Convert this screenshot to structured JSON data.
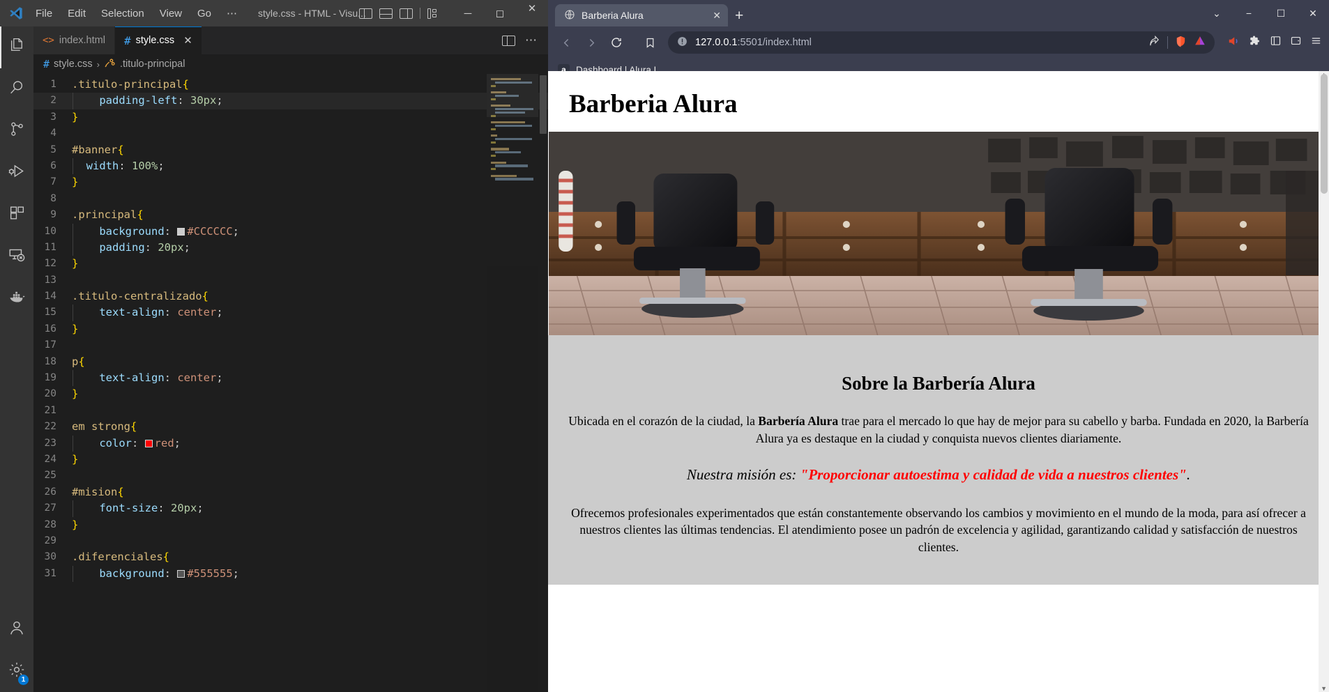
{
  "vscode": {
    "window_title": "style.css - HTML - Visu...",
    "menu": [
      "File",
      "Edit",
      "Selection",
      "View",
      "Go",
      "⋯"
    ],
    "layout_icons": [
      "panel-left-icon",
      "panel-bottom-icon",
      "panel-right-icon",
      "customize-layout-icon"
    ],
    "window_controls": [
      "minimize",
      "maximize",
      "close"
    ],
    "activity_bar": [
      {
        "name": "explorer",
        "icon": "files-icon"
      },
      {
        "name": "search",
        "icon": "search-icon"
      },
      {
        "name": "source-control",
        "icon": "source-control-icon"
      },
      {
        "name": "run-debug",
        "icon": "run-and-debug-icon"
      },
      {
        "name": "extensions",
        "icon": "extensions-icon"
      },
      {
        "name": "remote-explorer",
        "icon": "remote-explorer-icon"
      },
      {
        "name": "docker",
        "icon": "docker-icon"
      }
    ],
    "activity_bar_bottom": [
      {
        "name": "accounts",
        "icon": "account-icon"
      },
      {
        "name": "settings",
        "icon": "gear-icon",
        "badge": "1"
      }
    ],
    "tabs": [
      {
        "label": "index.html",
        "icon": "html-file-icon",
        "active": false
      },
      {
        "label": "style.css",
        "icon": "css-file-icon",
        "active": true
      }
    ],
    "tab_close_label": "✕",
    "tab_actions": [
      "split-editor-icon",
      "more-actions-icon"
    ],
    "breadcrumb": {
      "file_icon": "css-file-icon",
      "file": "style.css",
      "separator": "›",
      "symbol_icon": "css-selector-icon",
      "symbol": ".titulo-principal"
    },
    "code_lines": [
      {
        "n": 1,
        "tokens": [
          {
            "t": ".titulo-principal",
            "c": "k-sel"
          },
          {
            "t": "{",
            "c": "k-brace"
          }
        ]
      },
      {
        "n": 2,
        "hl": true,
        "indent": true,
        "tokens": [
          {
            "t": "    ",
            "c": "k-punc"
          },
          {
            "t": "padding-left",
            "c": "k-prop"
          },
          {
            "t": ": ",
            "c": "k-punc"
          },
          {
            "t": "30px",
            "c": "k-num"
          },
          {
            "t": ";",
            "c": "k-punc"
          }
        ]
      },
      {
        "n": 3,
        "tokens": [
          {
            "t": "}",
            "c": "k-brace"
          }
        ]
      },
      {
        "n": 4,
        "tokens": []
      },
      {
        "n": 5,
        "tokens": [
          {
            "t": "#banner",
            "c": "k-sel"
          },
          {
            "t": "{",
            "c": "k-brace"
          }
        ]
      },
      {
        "n": 6,
        "indent": true,
        "tokens": [
          {
            "t": "  ",
            "c": "k-punc"
          },
          {
            "t": "width",
            "c": "k-prop"
          },
          {
            "t": ": ",
            "c": "k-punc"
          },
          {
            "t": "100%",
            "c": "k-num"
          },
          {
            "t": ";",
            "c": "k-punc"
          }
        ]
      },
      {
        "n": 7,
        "tokens": [
          {
            "t": "}",
            "c": "k-brace"
          }
        ]
      },
      {
        "n": 8,
        "tokens": []
      },
      {
        "n": 9,
        "tokens": [
          {
            "t": ".principal",
            "c": "k-sel"
          },
          {
            "t": "{",
            "c": "k-brace"
          }
        ]
      },
      {
        "n": 10,
        "indent": true,
        "swatch": "#CCCCCC",
        "tokens": [
          {
            "t": "    ",
            "c": "k-punc"
          },
          {
            "t": "background",
            "c": "k-prop"
          },
          {
            "t": ": ",
            "c": "k-punc"
          },
          {
            "t": "#CCCCCC",
            "c": "k-val"
          },
          {
            "t": ";",
            "c": "k-punc"
          }
        ]
      },
      {
        "n": 11,
        "indent": true,
        "tokens": [
          {
            "t": "    ",
            "c": "k-punc"
          },
          {
            "t": "padding",
            "c": "k-prop"
          },
          {
            "t": ": ",
            "c": "k-punc"
          },
          {
            "t": "20px",
            "c": "k-num"
          },
          {
            "t": ";",
            "c": "k-punc"
          }
        ]
      },
      {
        "n": 12,
        "tokens": [
          {
            "t": "}",
            "c": "k-brace"
          }
        ]
      },
      {
        "n": 13,
        "tokens": []
      },
      {
        "n": 14,
        "tokens": [
          {
            "t": ".titulo-centralizado",
            "c": "k-sel"
          },
          {
            "t": "{",
            "c": "k-brace"
          }
        ]
      },
      {
        "n": 15,
        "indent": true,
        "tokens": [
          {
            "t": "    ",
            "c": "k-punc"
          },
          {
            "t": "text-align",
            "c": "k-prop"
          },
          {
            "t": ": ",
            "c": "k-punc"
          },
          {
            "t": "center",
            "c": "k-val"
          },
          {
            "t": ";",
            "c": "k-punc"
          }
        ]
      },
      {
        "n": 16,
        "tokens": [
          {
            "t": "}",
            "c": "k-brace"
          }
        ]
      },
      {
        "n": 17,
        "tokens": []
      },
      {
        "n": 18,
        "tokens": [
          {
            "t": "p",
            "c": "k-tag"
          },
          {
            "t": "{",
            "c": "k-brace"
          }
        ]
      },
      {
        "n": 19,
        "indent": true,
        "tokens": [
          {
            "t": "    ",
            "c": "k-punc"
          },
          {
            "t": "text-align",
            "c": "k-prop"
          },
          {
            "t": ": ",
            "c": "k-punc"
          },
          {
            "t": "center",
            "c": "k-val"
          },
          {
            "t": ";",
            "c": "k-punc"
          }
        ]
      },
      {
        "n": 20,
        "tokens": [
          {
            "t": "}",
            "c": "k-brace"
          }
        ]
      },
      {
        "n": 21,
        "tokens": []
      },
      {
        "n": 22,
        "tokens": [
          {
            "t": "em strong",
            "c": "k-tag"
          },
          {
            "t": "{",
            "c": "k-brace"
          }
        ]
      },
      {
        "n": 23,
        "indent": true,
        "swatch": "#ff0000",
        "tokens": [
          {
            "t": "    ",
            "c": "k-punc"
          },
          {
            "t": "color",
            "c": "k-prop"
          },
          {
            "t": ": ",
            "c": "k-punc"
          },
          {
            "t": "red",
            "c": "k-val"
          },
          {
            "t": ";",
            "c": "k-punc"
          }
        ]
      },
      {
        "n": 24,
        "tokens": [
          {
            "t": "}",
            "c": "k-brace"
          }
        ]
      },
      {
        "n": 25,
        "tokens": []
      },
      {
        "n": 26,
        "tokens": [
          {
            "t": "#mision",
            "c": "k-sel"
          },
          {
            "t": "{",
            "c": "k-brace"
          }
        ]
      },
      {
        "n": 27,
        "indent": true,
        "tokens": [
          {
            "t": "    ",
            "c": "k-punc"
          },
          {
            "t": "font-size",
            "c": "k-prop"
          },
          {
            "t": ": ",
            "c": "k-punc"
          },
          {
            "t": "20px",
            "c": "k-num"
          },
          {
            "t": ";",
            "c": "k-punc"
          }
        ]
      },
      {
        "n": 28,
        "tokens": [
          {
            "t": "}",
            "c": "k-brace"
          }
        ]
      },
      {
        "n": 29,
        "tokens": []
      },
      {
        "n": 30,
        "tokens": [
          {
            "t": ".diferenciales",
            "c": "k-sel"
          },
          {
            "t": "{",
            "c": "k-brace"
          }
        ]
      },
      {
        "n": 31,
        "indent": true,
        "swatch": "#555555",
        "tokens": [
          {
            "t": "    ",
            "c": "k-punc"
          },
          {
            "t": "background",
            "c": "k-prop"
          },
          {
            "t": ": ",
            "c": "k-punc"
          },
          {
            "t": "#555555",
            "c": "k-val"
          },
          {
            "t": ";",
            "c": "k-punc"
          }
        ]
      }
    ]
  },
  "browser": {
    "tab": {
      "title": "Barberia Alura",
      "favicon": "globe-icon",
      "close": "✕"
    },
    "new_tab_label": "+",
    "window_controls": {
      "tab_search": "⌄",
      "minimize": "−",
      "maximize": "☐",
      "close": "✕"
    },
    "toolbar": {
      "back": "◀",
      "forward": "▶",
      "reload": "↻",
      "bookmark": "bookmark-icon",
      "site_info_icon": "not-secure-icon",
      "url_host": "127.0.0.1",
      "url_rest": ":5501/index.html",
      "share_icon": "share-icon",
      "brave_shields_icon": "brave-shields-icon",
      "brave_rewards_icon": "brave-rewards-icon",
      "right_icons": [
        "brave-leo-icon",
        "extensions-puzzle-icon",
        "sidebar-icon",
        "wallet-icon",
        "menu-icon"
      ]
    },
    "bookmarks": [
      {
        "label": "Dashboard | Alura L...",
        "favicon": "a"
      }
    ]
  },
  "webpage": {
    "title": "Barberia Alura",
    "banner_alt": "barbershop-interior-banner",
    "section_title": "Sobre la Barbería Alura",
    "paragraph_1_pre": "Ubicada en el corazón de la ciudad, la ",
    "paragraph_1_bold": "Barbería Alura",
    "paragraph_1_post": " trae para el mercado lo que hay de mejor para su cabello y barba. Fundada en 2020, la Barbería Alura ya es destaque en la ciudad y conquista nuevos clientes diariamente.",
    "mision_label": "Nuestra misión es: ",
    "mision_quote": "\"Proporcionar autoestima y calidad de vida a nuestros clientes\"",
    "mision_end": ".",
    "paragraph_3": "Ofrecemos profesionales experimentados que están constantemente observando los cambios y movimiento en el mundo de la moda, para así ofrecer a nuestros clientes las últimas tendencias. El atendimiento posee un padrón de excelencia y agilidad, garantizando calidad y satisfacción de nuestros clientes."
  },
  "colors": {
    "vscode_bg": "#1e1e1e",
    "vscode_titlebar": "#3c3c3c",
    "activitybar": "#333333",
    "browser_chrome": "#3b3e4f",
    "page_section_bg": "#CCCCCC",
    "accent_red": "#ff0000",
    "badge_blue": "#0078d4"
  }
}
